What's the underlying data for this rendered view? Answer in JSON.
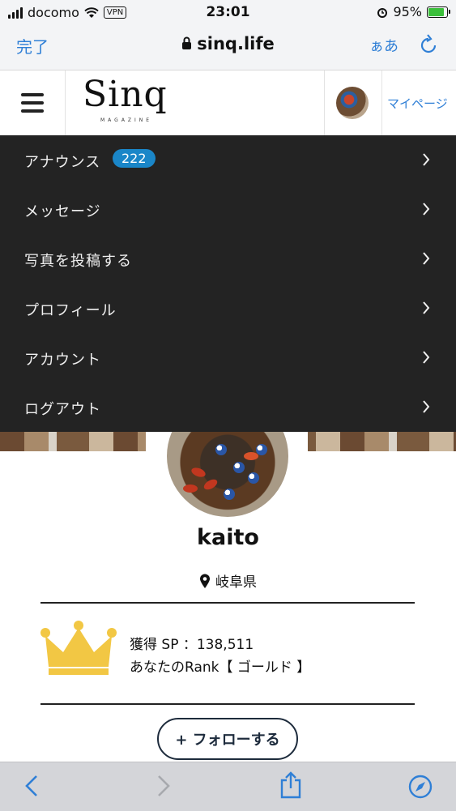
{
  "status_bar": {
    "carrier": "docomo",
    "vpn_label": "VPN",
    "time": "23:01",
    "battery": "95%"
  },
  "browser": {
    "done_label": "完了",
    "domain": "sinq.life",
    "text_size_label": "ぁあ"
  },
  "site_header": {
    "logo_text": "Sinq",
    "logo_sub": "MAGAZINE",
    "mypage_label": "マイページ"
  },
  "menu": {
    "items": [
      {
        "label": "アナウンス",
        "badge": "222"
      },
      {
        "label": "メッセージ"
      },
      {
        "label": "写真を投稿する"
      },
      {
        "label": "プロフィール"
      },
      {
        "label": "アカウント"
      },
      {
        "label": "ログアウト"
      }
    ]
  },
  "profile": {
    "username": "kaito",
    "location": "岐阜県",
    "sp_text": "獲得 SP ：138,511",
    "rank_text": "あなたのRank【 ゴールド 】",
    "follow_label": "+ フォローする"
  },
  "colors": {
    "link_blue": "#2f7fd6",
    "menu_bg": "#232323",
    "badge_blue": "#1a86c8",
    "crown_gold": "#f2c744"
  }
}
